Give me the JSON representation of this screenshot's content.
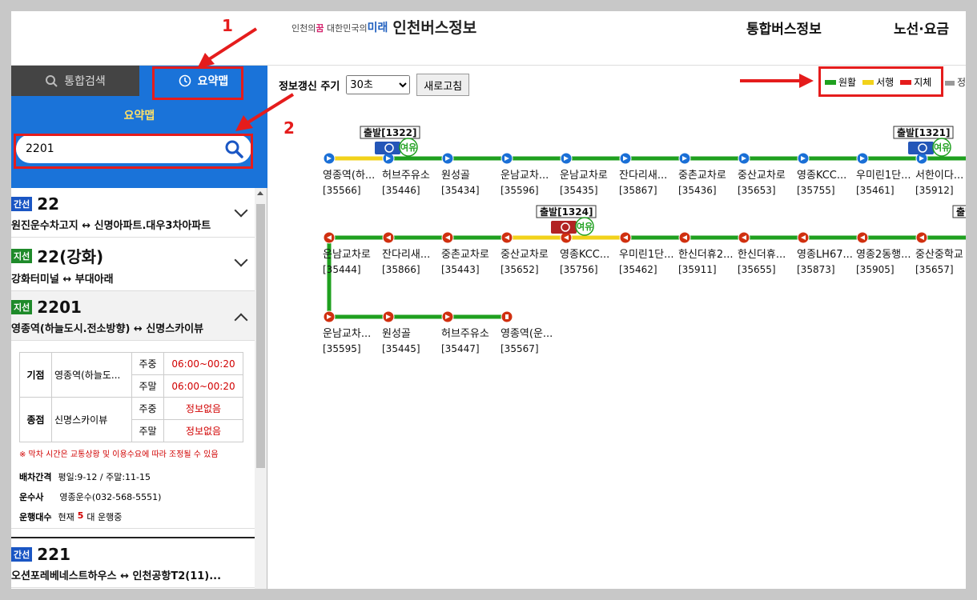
{
  "header": {
    "logo_small": "인천의",
    "logo_dream": "꿈",
    "logo_mid": "대한민국의",
    "logo_future": "미래",
    "logo_main": "인천버스정보",
    "nav1": "통합버스정보",
    "nav2": "노선·요금"
  },
  "annotations": {
    "n1": "1",
    "n2": "2"
  },
  "tabs": {
    "search": "통합검색",
    "summary": "요약맵"
  },
  "summary_title": "요약맵",
  "search": {
    "value": "2201"
  },
  "routes": [
    {
      "badge": "간선",
      "num": "22",
      "desc": "원진운수차고지 ↔ 신명아파트.대우3차아파트"
    },
    {
      "badge": "지선",
      "num": "22(강화)",
      "desc": "강화터미널 ↔ 부대아래"
    },
    {
      "badge": "지선",
      "num": "2201",
      "desc": "영종역(하늘도시.전소방향) ↔ 신명스카이뷰"
    },
    {
      "badge": "간선",
      "num": "221",
      "desc": "오션포레베네스트하우스 ↔ 인천공항T2(11)..."
    }
  ],
  "detail": {
    "start_label": "기점",
    "start_name": "영종역(하늘도...",
    "end_label": "종점",
    "end_name": "신명스카이뷰",
    "weekday": "주중",
    "weekend": "주말",
    "start_wd": "06:00~00:20",
    "start_we": "06:00~00:20",
    "end_wd": "정보없음",
    "end_we": "정보없음",
    "note": "※ 막차 시간은 교통상황 및 이용수요에 따라 조정될 수 있음",
    "interval_label": "배차간격",
    "interval_value": "평일:9-12 / 주말:11-15",
    "company_label": "운수사",
    "company_value": "영종운수(032-568-5551)",
    "count_label": "운행대수",
    "count_pre": "현재",
    "count_num": "5",
    "count_post": "대 운행중"
  },
  "controls": {
    "refresh_label": "정보갱신 주기",
    "interval_option": "30초",
    "refresh_button": "새로고침"
  },
  "legend": {
    "smooth": "원활",
    "slow": "서행",
    "jam": "지체",
    "info": "정보",
    "colors": {
      "smooth": "#1fa01f",
      "slow": "#f2d21a",
      "jam": "#e51c1c",
      "info": "#999999"
    }
  },
  "stops_row1": [
    {
      "name": "영종역(하...",
      "id": "[35566]"
    },
    {
      "name": "허브주유소",
      "id": "[35446]"
    },
    {
      "name": "원성골",
      "id": "[35434]"
    },
    {
      "name": "운남교차...",
      "id": "[35596]"
    },
    {
      "name": "운남교차로",
      "id": "[35435]"
    },
    {
      "name": "잔다리새...",
      "id": "[35867]"
    },
    {
      "name": "중촌교차로",
      "id": "[35436]"
    },
    {
      "name": "중산교차로",
      "id": "[35653]"
    },
    {
      "name": "영종KCC...",
      "id": "[35755]"
    },
    {
      "name": "우미린1단...",
      "id": "[35461]"
    },
    {
      "name": "서한이다...",
      "id": "[35912]"
    }
  ],
  "stops_row2": [
    {
      "name": "운남교차로",
      "id": "[35444]"
    },
    {
      "name": "잔다리새...",
      "id": "[35866]"
    },
    {
      "name": "중촌교차로",
      "id": "[35443]"
    },
    {
      "name": "중산교차로",
      "id": "[35652]"
    },
    {
      "name": "영종KCC...",
      "id": "[35756]"
    },
    {
      "name": "우미린1단...",
      "id": "[35462]"
    },
    {
      "name": "한신더휴2...",
      "id": "[35911]"
    },
    {
      "name": "한신더휴...",
      "id": "[35655]"
    },
    {
      "name": "영종LH67...",
      "id": "[35873]"
    },
    {
      "name": "영종2동행...",
      "id": "[35905]"
    },
    {
      "name": "중산중학교",
      "id": "[35657]"
    }
  ],
  "stops_row3": [
    {
      "name": "운남교차...",
      "id": "[35595]"
    },
    {
      "name": "원성골",
      "id": "[35445]"
    },
    {
      "name": "허브주유소",
      "id": "[35447]"
    },
    {
      "name": "영종역(운...",
      "id": "[35567]"
    }
  ],
  "buses": [
    {
      "label": "출발[1322]",
      "status": "여유",
      "type": "blue"
    },
    {
      "label": "출발[1321]",
      "status": "여유",
      "type": "blue"
    },
    {
      "label": "출발[1324]",
      "status": "여유",
      "type": "red"
    },
    {
      "label": "출발",
      "status": "",
      "type": "red"
    }
  ]
}
